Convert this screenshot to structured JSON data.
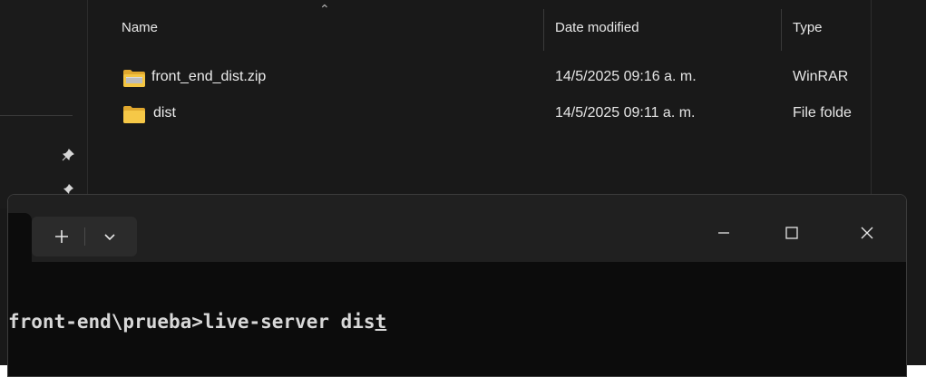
{
  "columns": {
    "name": "Name",
    "date_modified": "Date modified",
    "type": "Type"
  },
  "files": [
    {
      "name": "front_end_dist.zip",
      "date": "14/5/2025 09:16 a. m.",
      "type": "WinRAR",
      "icon": "zip-archive-icon"
    },
    {
      "name": "dist",
      "date": "14/5/2025 09:11 a. m.",
      "type": "File folde",
      "icon": "folder-icon"
    }
  ],
  "terminal": {
    "new_tab_icon": "plus-icon",
    "dropdown_icon": "chevron-down-icon",
    "prompt_text": "front-end\\prueba>live-server dis",
    "cursor_char": "t"
  },
  "colors": {
    "explorer_bg": "#191919",
    "terminal_bg": "#0c0c0c",
    "titlebar_bg": "#202020",
    "folder_yellow": "#f4c542"
  }
}
